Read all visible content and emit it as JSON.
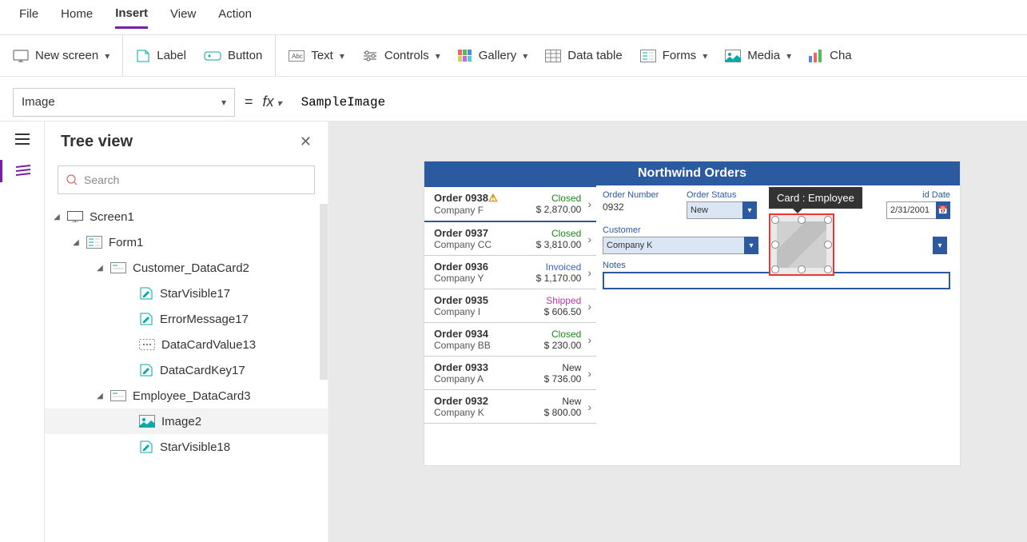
{
  "menu": [
    "File",
    "Home",
    "Insert",
    "View",
    "Action"
  ],
  "menu_active": "Insert",
  "ribbon": {
    "group1": {
      "new_screen": "New screen"
    },
    "group2": {
      "label": "Label",
      "button": "Button"
    },
    "group3": {
      "text": "Text",
      "controls": "Controls",
      "gallery": "Gallery",
      "data_table": "Data table",
      "forms": "Forms",
      "media": "Media",
      "charts": "Cha"
    }
  },
  "formula": {
    "property": "Image",
    "fx": "fx",
    "value": "SampleImage"
  },
  "tree": {
    "title": "Tree view",
    "search_placeholder": "Search",
    "nodes": [
      {
        "depth": 0,
        "icon": "screen",
        "label": "Screen1",
        "caret": true
      },
      {
        "depth": 1,
        "icon": "form",
        "label": "Form1",
        "caret": true
      },
      {
        "depth": 2,
        "icon": "card",
        "label": "Customer_DataCard2",
        "caret": true
      },
      {
        "depth": 3,
        "icon": "pen",
        "label": "StarVisible17"
      },
      {
        "depth": 3,
        "icon": "pen",
        "label": "ErrorMessage17"
      },
      {
        "depth": 3,
        "icon": "dots",
        "label": "DataCardValue13"
      },
      {
        "depth": 3,
        "icon": "pen",
        "label": "DataCardKey17"
      },
      {
        "depth": 2,
        "icon": "card",
        "label": "Employee_DataCard3",
        "caret": true
      },
      {
        "depth": 3,
        "icon": "image",
        "label": "Image2",
        "selected": true
      },
      {
        "depth": 3,
        "icon": "pen",
        "label": "StarVisible18"
      }
    ]
  },
  "app": {
    "title": "Northwind Orders",
    "orders": [
      {
        "num": "Order 0938",
        "warn": true,
        "company": "Company F",
        "status": "Closed",
        "status_cls": "closed",
        "amount": "$ 2,870.00"
      },
      {
        "num": "Order 0937",
        "company": "Company CC",
        "status": "Closed",
        "status_cls": "closed",
        "amount": "$ 3,810.00"
      },
      {
        "num": "Order 0936",
        "company": "Company Y",
        "status": "Invoiced",
        "status_cls": "invoiced",
        "amount": "$ 1,170.00"
      },
      {
        "num": "Order 0935",
        "company": "Company I",
        "status": "Shipped",
        "status_cls": "shipped",
        "amount": "$ 606.50"
      },
      {
        "num": "Order 0934",
        "company": "Company BB",
        "status": "Closed",
        "status_cls": "closed",
        "amount": "$ 230.00"
      },
      {
        "num": "Order 0933",
        "company": "Company A",
        "status": "New",
        "status_cls": "new",
        "amount": "$ 736.00"
      },
      {
        "num": "Order 0932",
        "company": "Company K",
        "status": "New",
        "status_cls": "new",
        "amount": "$ 800.00"
      }
    ],
    "detail": {
      "order_number_label": "Order Number",
      "order_number": "0932",
      "order_status_label": "Order Status",
      "order_status": "New",
      "paid_date_label": "id Date",
      "paid_date": "2/31/2001",
      "customer_label": "Customer",
      "customer": "Company K",
      "notes_label": "Notes",
      "tooltip": "Card : Employee"
    }
  }
}
